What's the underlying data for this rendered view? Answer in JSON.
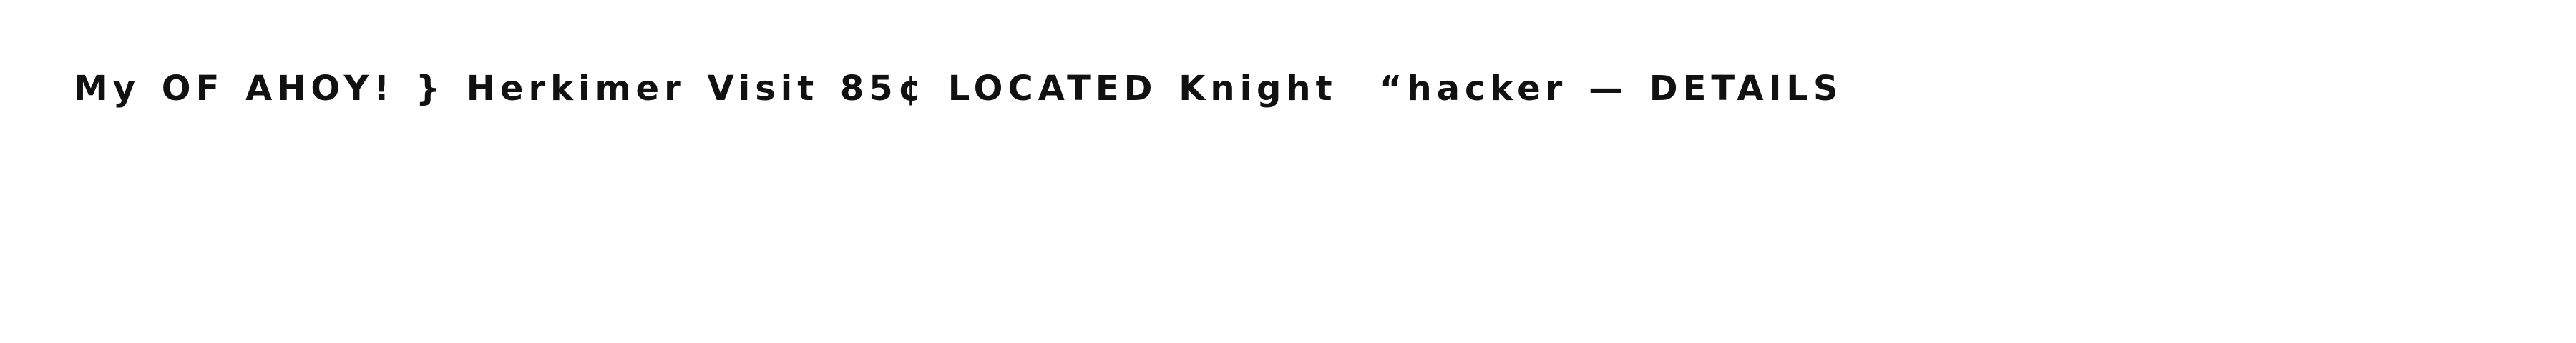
{
  "document": {
    "text_line": "My OF AHOY! } Herkimer Visit 85¢ LOCATED Knight  “hacker — DETAILS"
  }
}
